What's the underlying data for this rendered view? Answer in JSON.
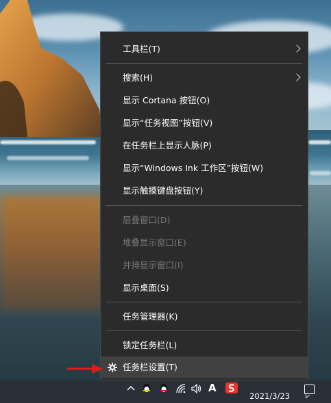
{
  "menu": {
    "items": [
      {
        "label": "工具栏(T)",
        "submenu": true,
        "enabled": true
      },
      {
        "label": "搜索(H)",
        "submenu": true,
        "enabled": true
      },
      {
        "label": "显示 Cortana 按钮(O)",
        "enabled": true
      },
      {
        "label": "显示“任务视图”按钮(V)",
        "enabled": true
      },
      {
        "label": "在任务栏上显示人脉(P)",
        "enabled": true
      },
      {
        "label": "显示“Windows Ink 工作区”按钮(W)",
        "enabled": true
      },
      {
        "label": "显示触摸键盘按钮(Y)",
        "enabled": true
      },
      {
        "label": "层叠窗口(D)",
        "enabled": false
      },
      {
        "label": "堆叠显示窗口(E)",
        "enabled": false
      },
      {
        "label": "并排显示窗口(I)",
        "enabled": false
      },
      {
        "label": "显示桌面(S)",
        "enabled": true
      },
      {
        "label": "任务管理器(K)",
        "enabled": true
      },
      {
        "label": "锁定任务栏(L)",
        "enabled": true
      },
      {
        "label": "任务栏设置(T)",
        "enabled": true,
        "highlighted": true,
        "icon": "gear-icon"
      }
    ]
  },
  "taskbar": {
    "date": "2021/3/23",
    "ime_label": "A",
    "tray_icons": [
      "chevron-up-icon",
      "qq-icon",
      "qq-icon-2",
      "wifi-icon",
      "volume-icon",
      "ime-icon",
      "sogou-icon",
      "notification-icon"
    ]
  },
  "colors": {
    "menu_bg": "#2b2b2b",
    "highlight_bg": "#414141",
    "disabled_text": "#7a7a7a",
    "annotation_arrow": "#e01b1b"
  }
}
